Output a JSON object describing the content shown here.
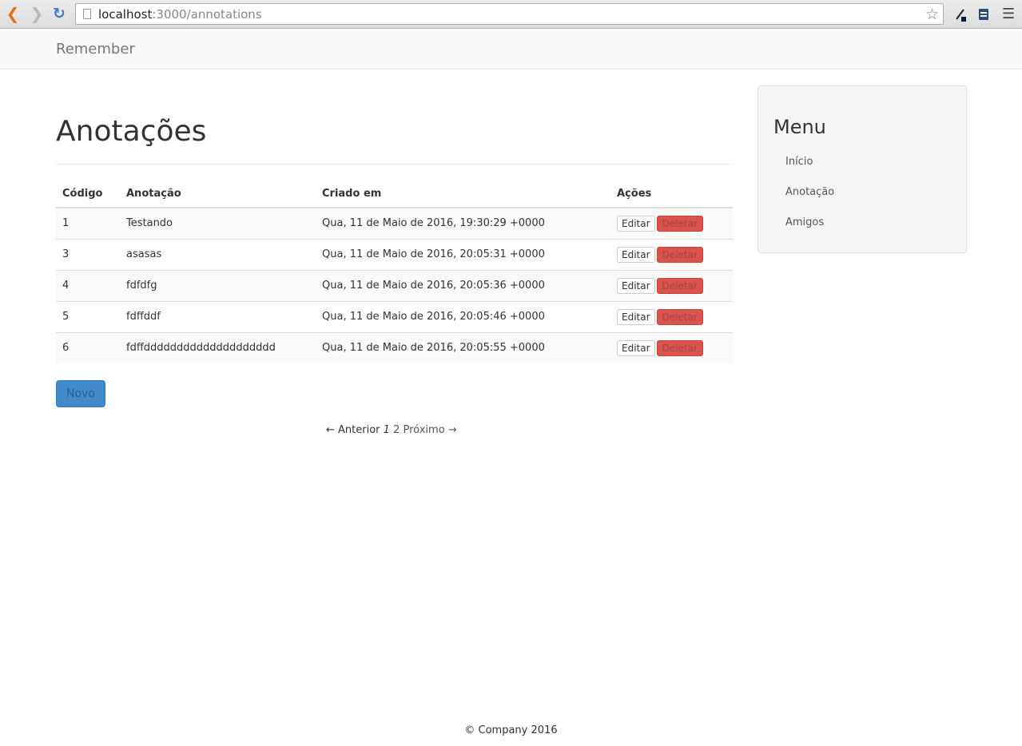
{
  "browser": {
    "url_host": "localhost",
    "url_path": ":3000/annotations",
    "icons": [
      "back-icon",
      "forward-icon",
      "reload-icon",
      "page-icon",
      "star-icon",
      "eyedropper-icon",
      "extension-icon",
      "menu-icon"
    ]
  },
  "navbar": {
    "brand": "Remember"
  },
  "main": {
    "title": "Anotações",
    "table": {
      "headers": [
        "Código",
        "Anotação",
        "Criado em",
        "Ações"
      ],
      "rows": [
        {
          "code": "1",
          "note": "Testando",
          "created": "Qua, 11 de Maio de 2016, 19:30:29 +0000"
        },
        {
          "code": "3",
          "note": "asasas",
          "created": "Qua, 11 de Maio de 2016, 20:05:31 +0000"
        },
        {
          "code": "4",
          "note": "fdfdfg",
          "created": "Qua, 11 de Maio de 2016, 20:05:36 +0000"
        },
        {
          "code": "5",
          "note": "fdffddf",
          "created": "Qua, 11 de Maio de 2016, 20:05:46 +0000"
        },
        {
          "code": "6",
          "note": "fdffdddddddddddddddddddd",
          "created": "Qua, 11 de Maio de 2016, 20:05:55 +0000"
        }
      ],
      "edit_label": "Editar",
      "delete_label": "Deletar"
    },
    "new_button": "Novo",
    "pagination": {
      "prev": "← Anterior",
      "current": "1",
      "page2": "2",
      "next": "Próximo →"
    }
  },
  "sidebar": {
    "title": "Menu",
    "items": [
      "Início",
      "Anotação",
      "Amigos"
    ]
  },
  "footer": {
    "text": "© Company 2016"
  },
  "colors": {
    "primary": "#428bca",
    "danger": "#d9534f",
    "navbar_bg": "#f8f8f8"
  }
}
